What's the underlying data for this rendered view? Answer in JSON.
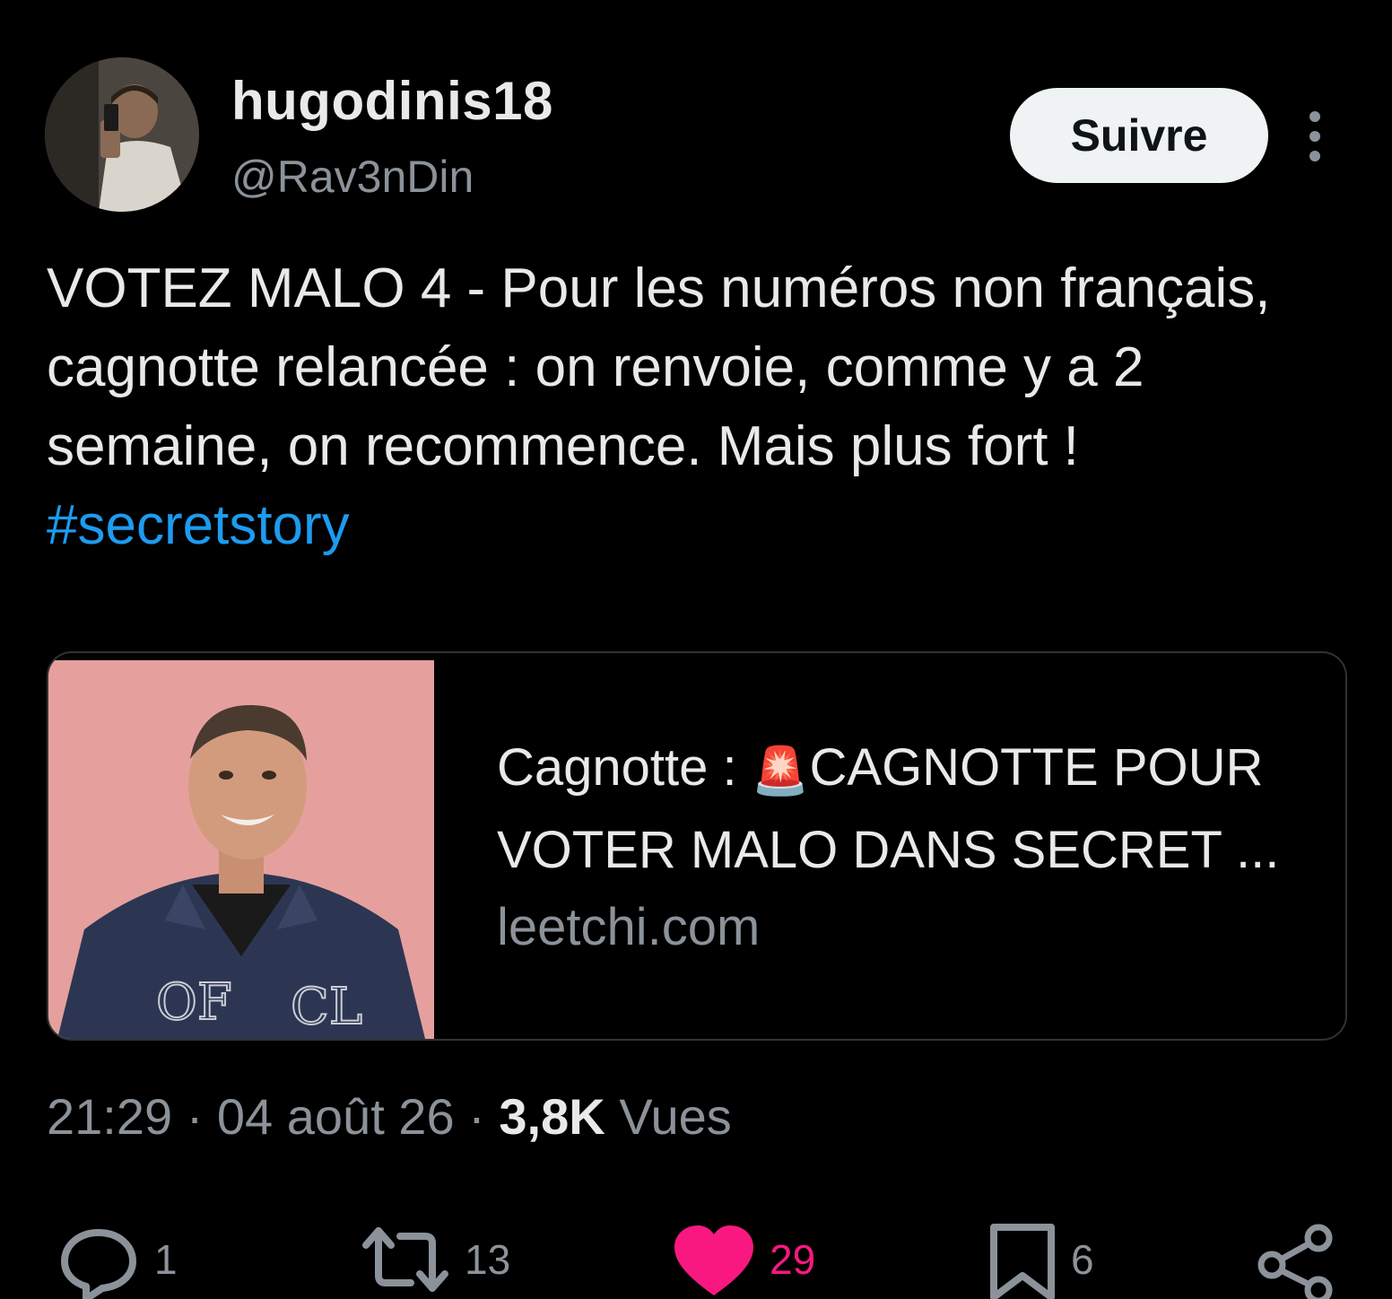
{
  "tweet": {
    "author": {
      "display_name": "hugodinis18",
      "handle": "@Rav3nDin"
    },
    "follow_label": "Suivre",
    "more_icon": "more-vertical-icon",
    "text": "VOTEZ MALO 4 - Pour les numéros non français, cagnotte relancée : on renvoie, comme y a 2 semaine, on recommence. Mais plus fort ! ",
    "hashtag": "#secretstory",
    "link_card": {
      "title_prefix": "Cagnotte : ",
      "emoji": "🚨",
      "title_rest": "CAGNOTTE POUR VOTER MALO DANS SECRET ...",
      "domain": "leetchi.com"
    },
    "meta": {
      "time": "21:29",
      "separator": " · ",
      "date": "04 août 26",
      "views_count": "3,8K",
      "views_label": " Vues"
    },
    "actions": {
      "replies": "1",
      "retweets": "13",
      "likes": "29",
      "bookmarks": "6"
    }
  },
  "colors": {
    "background": "#000000",
    "text": "#e7e9ea",
    "secondary": "#8b9299",
    "link": "#1d9bf0",
    "like": "#f91880"
  }
}
